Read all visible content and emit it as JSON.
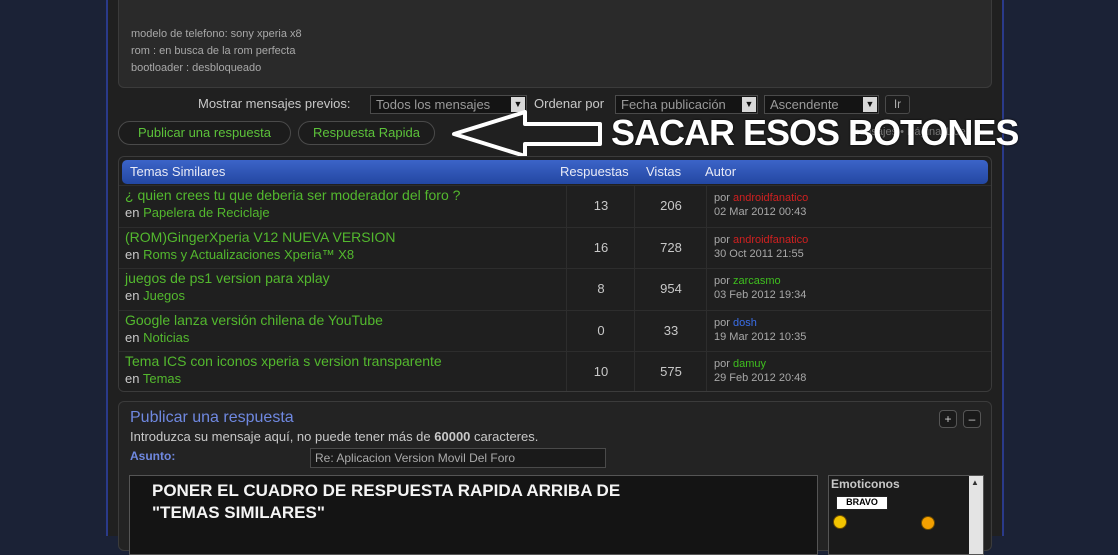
{
  "signature": {
    "lines": [
      "modelo de telefono: sony xperia x8",
      "rom : en busca de la rom perfecta",
      "bootloader : desbloqueado"
    ]
  },
  "sort": {
    "show_label": "Mostrar mensajes previos:",
    "show_value": "Todos los mensajes",
    "order_label": "Ordenar por",
    "order_value": "Fecha publicación",
    "direction_value": "Ascendente",
    "go_label": "Ir"
  },
  "actions": {
    "post_reply": "Publicar una respuesta",
    "quick_reply": "Respuesta Rapida",
    "pager_hint": "mensajes • Página 1 de"
  },
  "annotations": {
    "top": "SACAR ESOS BOTONES",
    "editor_line1": "PONER EL CUADRO DE RESPUESTA RAPIDA ARRIBA DE",
    "editor_line2": "\"TEMAS SIMILARES\""
  },
  "similar": {
    "headers": {
      "topics": "Temas Similares",
      "replies": "Respuestas",
      "views": "Vistas",
      "author": "Autor"
    },
    "in_word": "en",
    "by_word": "por",
    "rows": [
      {
        "title": "¿ quien crees tu que deberia ser moderador del foro ?",
        "forum": "Papelera de Reciclaje",
        "replies": "13",
        "views": "206",
        "author": "androidfanatico",
        "author_color": "#d02020",
        "date": "02 Mar 2012 00:43"
      },
      {
        "title": "(ROM)GingerXperia V12 NUEVA VERSION",
        "forum": "Roms y Actualizaciones Xperia™ X8",
        "replies": "16",
        "views": "728",
        "author": "androidfanatico",
        "author_color": "#d02020",
        "date": "30 Oct 2011 21:55"
      },
      {
        "title": "juegos de ps1 version para xplay",
        "forum": "Juegos",
        "replies": "8",
        "views": "954",
        "author": "zarcasmo",
        "author_color": "#3fbf1f",
        "date": "03 Feb 2012 19:34"
      },
      {
        "title": "Google lanza versión chilena de YouTube",
        "forum": "Noticias",
        "replies": "0",
        "views": "33",
        "author": "dosh",
        "author_color": "#3a6ee8",
        "date": "19 Mar 2012 10:35"
      },
      {
        "title": "Tema ICS con iconos xperia s version transparente",
        "forum": "Temas",
        "replies": "10",
        "views": "575",
        "author": "damuy",
        "author_color": "#3fbf1f",
        "date": "29 Feb 2012 20:48"
      }
    ]
  },
  "reply": {
    "title": "Publicar una respuesta",
    "hint_prefix": "Introduzca su mensaje aquí, no puede tener más de",
    "hint_limit": "60000",
    "hint_suffix": "caracteres.",
    "subject_label": "Asunto:",
    "subject_value": "Re: Aplicacion Version Movil Del Foro",
    "expand_label": "+",
    "collapse_label": "–",
    "emoticons_label": "Emoticonos",
    "bravo_label": "BRAVO"
  }
}
